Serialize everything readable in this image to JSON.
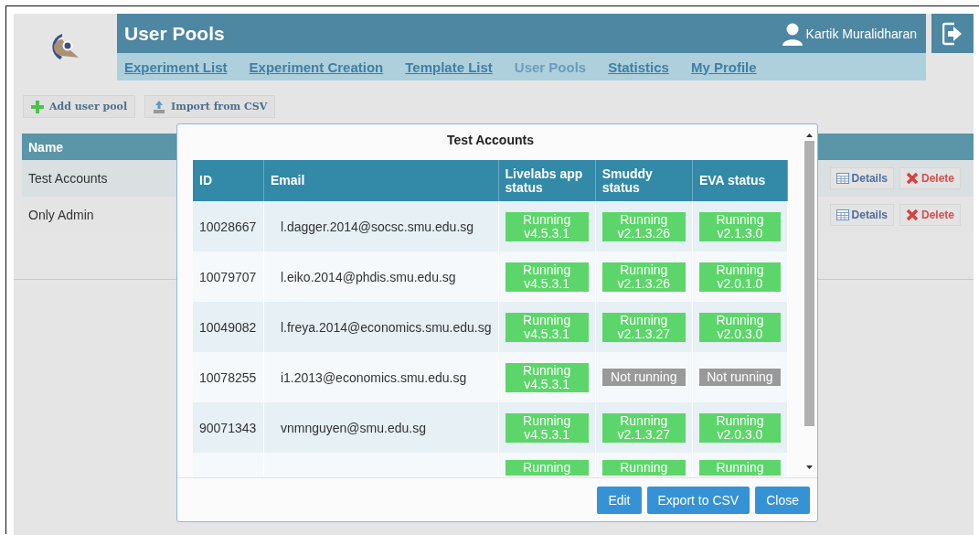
{
  "header": {
    "title": "User Pools",
    "user": "Kartik Muralidharan"
  },
  "nav": [
    {
      "label": "Experiment List",
      "selected": false
    },
    {
      "label": "Experiment Creation",
      "selected": false
    },
    {
      "label": "Template List",
      "selected": false
    },
    {
      "label": "User Pools",
      "selected": true
    },
    {
      "label": "Statistics",
      "selected": false
    },
    {
      "label": "My Profile",
      "selected": false
    }
  ],
  "toolbar": [
    {
      "label": "Add user pool",
      "kind": "add"
    },
    {
      "label": "Import from CSV",
      "kind": "import"
    }
  ],
  "pools": {
    "columns": [
      "Name"
    ],
    "rows": [
      {
        "name": "Test Accounts",
        "actions": [
          "Details",
          "Delete"
        ]
      },
      {
        "name": "Only Admin",
        "actions": [
          "Details",
          "Delete"
        ]
      }
    ]
  },
  "dialog": {
    "title": "Test Accounts",
    "columns": [
      "ID",
      "Email",
      "Livelabs app status",
      "Smuddy status",
      "EVA status"
    ],
    "rows": [
      {
        "id": "10028667",
        "email": "l.dagger.2014@socsc.smu.edu.sg",
        "statuses": [
          {
            "running": true,
            "lines": [
              "Running",
              "v4.5.3.1"
            ]
          },
          {
            "running": true,
            "lines": [
              "Running",
              "v2.1.3.26"
            ]
          },
          {
            "running": true,
            "lines": [
              "Running",
              "v2.1.3.0"
            ]
          }
        ]
      },
      {
        "id": "10079707",
        "email": "l.eiko.2014@phdis.smu.edu.sg",
        "statuses": [
          {
            "running": true,
            "lines": [
              "Running",
              "v4.5.3.1"
            ]
          },
          {
            "running": true,
            "lines": [
              "Running",
              "v2.1.3.26"
            ]
          },
          {
            "running": true,
            "lines": [
              "Running",
              "v2.0.1.0"
            ]
          }
        ]
      },
      {
        "id": "10049082",
        "email": "l.freya.2014@economics.smu.edu.sg",
        "statuses": [
          {
            "running": true,
            "lines": [
              "Running",
              "v4.5.3.1"
            ]
          },
          {
            "running": true,
            "lines": [
              "Running",
              "v2.1.3.27"
            ]
          },
          {
            "running": true,
            "lines": [
              "Running",
              "v2.0.3.0"
            ]
          }
        ]
      },
      {
        "id": "10078255",
        "email": "i1.2013@economics.smu.edu.sg",
        "statuses": [
          {
            "running": true,
            "lines": [
              "Running",
              "v4.5.3.1"
            ]
          },
          {
            "running": false,
            "lines": [
              "Not running"
            ]
          },
          {
            "running": false,
            "lines": [
              "Not running"
            ]
          }
        ]
      },
      {
        "id": "90071343",
        "email": "vnmnguyen@smu.edu.sg",
        "statuses": [
          {
            "running": true,
            "lines": [
              "Running",
              "v4.5.3.1"
            ]
          },
          {
            "running": true,
            "lines": [
              "Running",
              "v2.1.3.27"
            ]
          },
          {
            "running": true,
            "lines": [
              "Running",
              "v2.0.3.0"
            ]
          }
        ]
      },
      {
        "statuses": [
          {
            "running": true,
            "lines": [
              "Running"
            ]
          },
          {
            "running": true,
            "lines": [
              "Running"
            ]
          },
          {
            "running": true,
            "lines": [
              "Running"
            ]
          }
        ]
      }
    ],
    "buttons": [
      "Edit",
      "Export to CSV",
      "Close"
    ]
  }
}
